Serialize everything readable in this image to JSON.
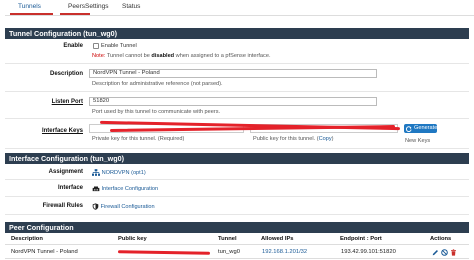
{
  "tabs": [
    {
      "label": "Tunnels",
      "active": true
    },
    {
      "label": "Peers",
      "active": false
    },
    {
      "label": "Settings",
      "active": false
    },
    {
      "label": "Status",
      "active": false
    }
  ],
  "tunnel_section": {
    "title": "Tunnel Configuration (tun_wg0)",
    "enable": {
      "label": "Enable",
      "checkbox_label": "Enable Tunnel",
      "help_note": "Note:",
      "help_pre": " Tunnel cannot be ",
      "help_bold": "disabled",
      "help_post": " when assigned to a pfSense interface."
    },
    "description": {
      "label": "Description",
      "value": "NordVPN Tunnel - Poland",
      "help": "Description for administrative reference (not parsed)."
    },
    "listen_port": {
      "label": "Listen Port",
      "value": "51820",
      "help": "Port used by this tunnel to communicate with peers."
    },
    "interface_keys": {
      "label": "Interface Keys",
      "private_help": "Private key for this tunnel. (Required)",
      "public_help_pre": "Public key for this tunnel. (",
      "public_help_link": "Copy",
      "public_help_post": ")",
      "generate_label": "Generate",
      "new_keys_label": "New Keys"
    }
  },
  "interface_section": {
    "title": "Interface Configuration (tun_wg0)",
    "assignment": {
      "label": "Assignment",
      "value": "NORDVPN (opt1)"
    },
    "interface": {
      "label": "Interface",
      "value": "Interface Configuration"
    },
    "firewall_rules": {
      "label": "Firewall Rules",
      "value": "Firewall Configuration"
    }
  },
  "peer_section": {
    "title": "Peer Configuration",
    "columns": {
      "description": "Description",
      "public_key": "Public key",
      "tunnel": "Tunnel",
      "allowed_ips": "Allowed IPs",
      "endpoint": "Endpoint : Port",
      "actions": "Actions"
    },
    "rows": [
      {
        "description": "NordVPN Tunnel - Poland",
        "tunnel": "tun_wg0",
        "allowed_ips": "192.168.1.201/32",
        "endpoint": "193.42.99.101:51820"
      }
    ]
  },
  "icons": {
    "generate": "refresh-icon",
    "assignment": "network-icon",
    "interface": "ethernet-port-icon",
    "firewall": "shield-icon",
    "edit": "pencil-icon",
    "disable": "ban-icon",
    "delete": "trash-icon"
  },
  "colors": {
    "header_bg": "#2d3e50",
    "active_tab_underline": "#c9302c",
    "link": "#1a5a96",
    "button_blue": "#1f78c2",
    "redaction": "#e4222a"
  }
}
